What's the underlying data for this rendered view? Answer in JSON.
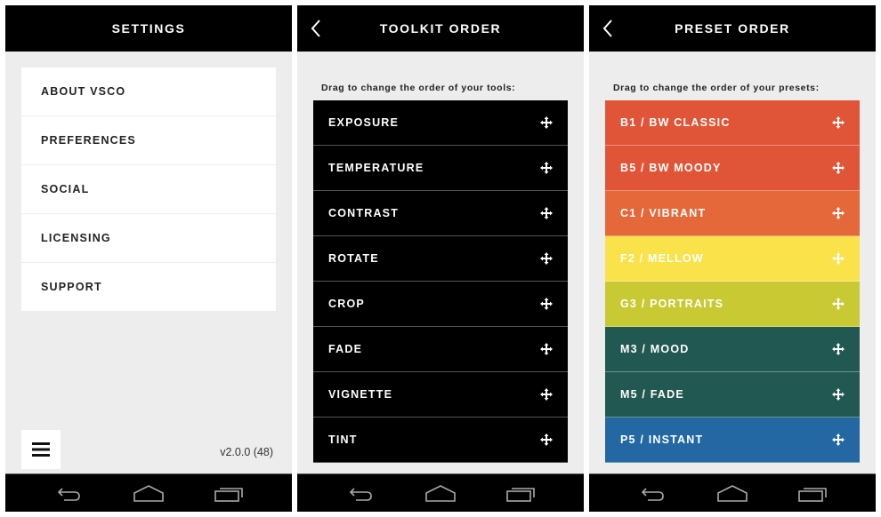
{
  "screens": {
    "settings": {
      "title": "SETTINGS",
      "items": [
        {
          "label": "ABOUT VSCO"
        },
        {
          "label": "PREFERENCES"
        },
        {
          "label": "SOCIAL"
        },
        {
          "label": "LICENSING"
        },
        {
          "label": "SUPPORT"
        }
      ],
      "menu_icon": "hamburger-menu-icon",
      "version": "v2.0.0 (48)"
    },
    "toolkit": {
      "title": "TOOLKIT ORDER",
      "back_icon": "chevron-left-icon",
      "instruction": "Drag to change the order of your tools:",
      "items": [
        {
          "label": "EXPOSURE"
        },
        {
          "label": "TEMPERATURE"
        },
        {
          "label": "CONTRAST"
        },
        {
          "label": "ROTATE"
        },
        {
          "label": "CROP"
        },
        {
          "label": "FADE"
        },
        {
          "label": "VIGNETTE"
        },
        {
          "label": "TINT"
        }
      ],
      "item_color": "#000000",
      "drag_icon": "move-arrows-icon"
    },
    "presets": {
      "title": "PRESET ORDER",
      "back_icon": "chevron-left-icon",
      "instruction": "Drag to change the order of your presets:",
      "items": [
        {
          "label": "B1 / BW CLASSIC",
          "color": "#e05537"
        },
        {
          "label": "B5 / BW MOODY",
          "color": "#e05537"
        },
        {
          "label": "C1 / VIBRANT",
          "color": "#e4683a"
        },
        {
          "label": "F2 / MELLOW",
          "color": "#f9e24a"
        },
        {
          "label": "G3 / PORTRAITS",
          "color": "#c9c934"
        },
        {
          "label": "M3 / MOOD",
          "color": "#225852"
        },
        {
          "label": "M5 / FADE",
          "color": "#225852"
        },
        {
          "label": "P5 / INSTANT",
          "color": "#2368a2"
        }
      ],
      "drag_icon": "move-arrows-icon"
    }
  },
  "system_nav": {
    "icons": [
      "back-icon",
      "home-icon",
      "recent-apps-icon"
    ]
  },
  "colors": {
    "topbar": "#000000",
    "background": "#ededed",
    "list_background": "#ffffff"
  }
}
